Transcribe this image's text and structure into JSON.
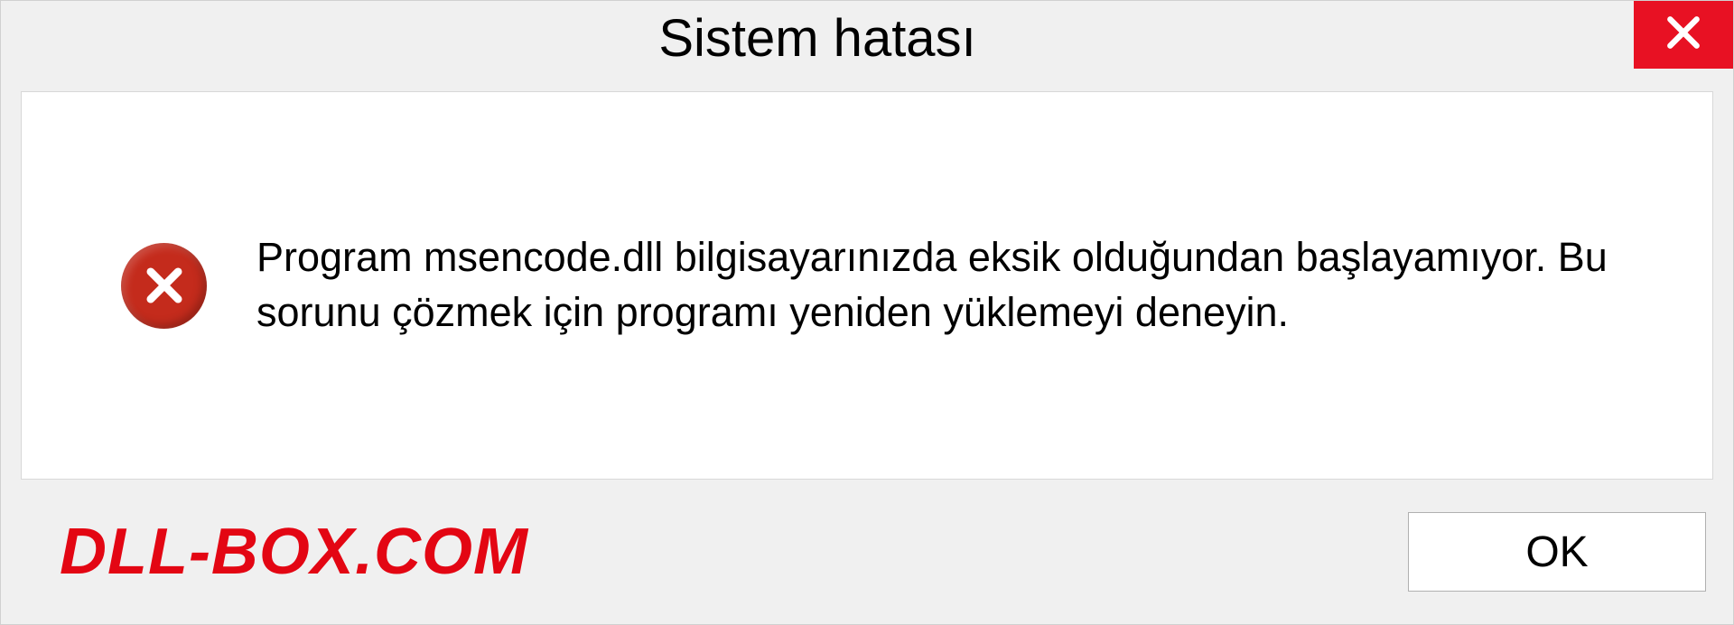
{
  "dialog": {
    "title": "Sistem hatası",
    "message": "Program msencode.dll bilgisayarınızda eksik olduğundan başlayamıyor. Bu sorunu çözmek için programı yeniden yüklemeyi deneyin.",
    "ok_label": "OK"
  },
  "watermark": "DLL-BOX.COM"
}
